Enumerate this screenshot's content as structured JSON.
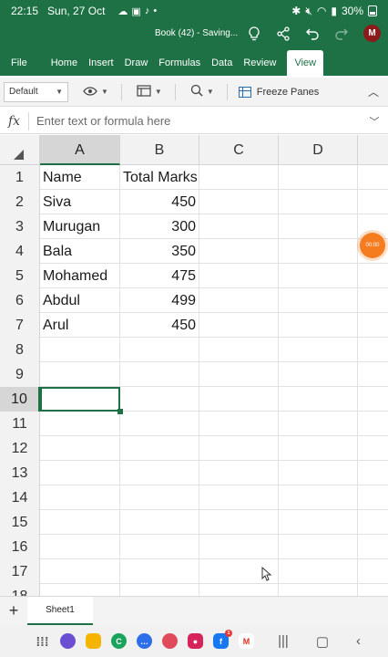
{
  "status_bar": {
    "time": "22:15",
    "date": "Sun, 27 Oct",
    "battery": "30%"
  },
  "title_bar": {
    "doc_title": "Book (42) - Saving...",
    "avatar_initial": "M"
  },
  "ribbon": {
    "tabs": [
      {
        "label": "File"
      },
      {
        "label": "Home"
      },
      {
        "label": "Insert"
      },
      {
        "label": "Draw"
      },
      {
        "label": "Formulas"
      },
      {
        "label": "Data"
      },
      {
        "label": "Review"
      },
      {
        "label": "View"
      }
    ],
    "active_tab": "View"
  },
  "toolbar": {
    "cell_style_value": "Default",
    "freeze_panes_label": "Freeze Panes"
  },
  "formula_bar": {
    "fx_label": "fx",
    "placeholder": "Enter text or formula here",
    "value": ""
  },
  "grid": {
    "columns": [
      "A",
      "B",
      "C",
      "D"
    ],
    "selected_column": "A",
    "rows": [
      {
        "num": "1",
        "a": "Name",
        "b": "Total Marks"
      },
      {
        "num": "2",
        "a": "Siva",
        "b": "450"
      },
      {
        "num": "3",
        "a": "Murugan",
        "b": "300"
      },
      {
        "num": "4",
        "a": "Bala",
        "b": "350"
      },
      {
        "num": "5",
        "a": "Mohamed",
        "b": "475"
      },
      {
        "num": "6",
        "a": "Abdul",
        "b": "499"
      },
      {
        "num": "7",
        "a": "Arul",
        "b": "450"
      },
      {
        "num": "8",
        "a": "",
        "b": ""
      },
      {
        "num": "9",
        "a": "",
        "b": ""
      },
      {
        "num": "10",
        "a": "",
        "b": ""
      },
      {
        "num": "11",
        "a": "",
        "b": ""
      },
      {
        "num": "12",
        "a": "",
        "b": ""
      },
      {
        "num": "13",
        "a": "",
        "b": ""
      },
      {
        "num": "14",
        "a": "",
        "b": ""
      },
      {
        "num": "15",
        "a": "",
        "b": ""
      },
      {
        "num": "16",
        "a": "",
        "b": ""
      },
      {
        "num": "17",
        "a": "",
        "b": ""
      },
      {
        "num": "18",
        "a": "",
        "b": ""
      }
    ],
    "active_cell": "A10"
  },
  "floating_recorder": {
    "text": "00:00"
  },
  "sheets": {
    "tabs": [
      "Sheet1"
    ]
  },
  "colors": {
    "brand_green": "#1e7145",
    "recorder_orange": "#f57c1f"
  },
  "nav_bar": {
    "apps": [
      {
        "icon": "app-drawer-icon"
      },
      {
        "icon": "galaxy-store-icon",
        "color": "#6a4fd3"
      },
      {
        "icon": "my-files-icon",
        "color": "#f5b400"
      },
      {
        "icon": "phone-icon",
        "color": "#1aa35a"
      },
      {
        "icon": "messages-icon",
        "color": "#2d6fe8"
      },
      {
        "icon": "contacts-icon",
        "color": "#e04a5a"
      },
      {
        "icon": "screen-recorder-icon",
        "color": "#d6245b"
      },
      {
        "icon": "facebook-icon",
        "color": "#1877f2",
        "badge": "1"
      },
      {
        "icon": "gmail-icon",
        "color": "#ffffff"
      }
    ]
  }
}
